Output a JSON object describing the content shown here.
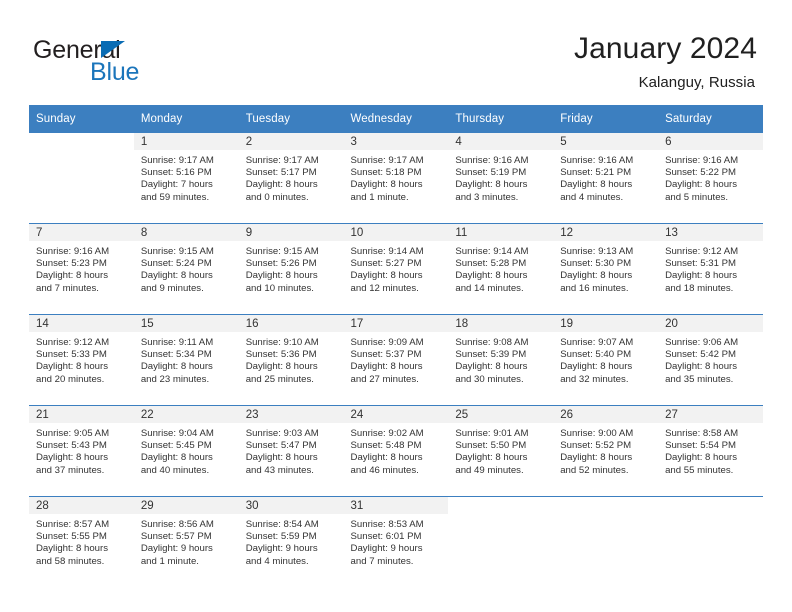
{
  "brand": {
    "name_part1": "General",
    "name_part2": "Blue",
    "triangle_color": "#0a6cb4",
    "blue_text_color": "#1b75bb"
  },
  "header": {
    "title": "January 2024",
    "subtitle": "Kalanguy, Russia"
  },
  "theme": {
    "header_row_bg": "#3c7fc0",
    "header_row_text": "#ffffff",
    "daynum_band_bg": "#f2f2f2",
    "cell_text": "#333333",
    "week_divider": "#3c7fc0"
  },
  "weekdays": [
    "Sunday",
    "Monday",
    "Tuesday",
    "Wednesday",
    "Thursday",
    "Friday",
    "Saturday"
  ],
  "weeks": [
    [
      {
        "day": "",
        "sunrise": "",
        "sunset": "",
        "daylight1": "",
        "daylight2": "",
        "blank": true
      },
      {
        "day": "1",
        "sunrise": "Sunrise: 9:17 AM",
        "sunset": "Sunset: 5:16 PM",
        "daylight1": "Daylight: 7 hours",
        "daylight2": "and 59 minutes."
      },
      {
        "day": "2",
        "sunrise": "Sunrise: 9:17 AM",
        "sunset": "Sunset: 5:17 PM",
        "daylight1": "Daylight: 8 hours",
        "daylight2": "and 0 minutes."
      },
      {
        "day": "3",
        "sunrise": "Sunrise: 9:17 AM",
        "sunset": "Sunset: 5:18 PM",
        "daylight1": "Daylight: 8 hours",
        "daylight2": "and 1 minute."
      },
      {
        "day": "4",
        "sunrise": "Sunrise: 9:16 AM",
        "sunset": "Sunset: 5:19 PM",
        "daylight1": "Daylight: 8 hours",
        "daylight2": "and 3 minutes."
      },
      {
        "day": "5",
        "sunrise": "Sunrise: 9:16 AM",
        "sunset": "Sunset: 5:21 PM",
        "daylight1": "Daylight: 8 hours",
        "daylight2": "and 4 minutes."
      },
      {
        "day": "6",
        "sunrise": "Sunrise: 9:16 AM",
        "sunset": "Sunset: 5:22 PM",
        "daylight1": "Daylight: 8 hours",
        "daylight2": "and 5 minutes."
      }
    ],
    [
      {
        "day": "7",
        "sunrise": "Sunrise: 9:16 AM",
        "sunset": "Sunset: 5:23 PM",
        "daylight1": "Daylight: 8 hours",
        "daylight2": "and 7 minutes."
      },
      {
        "day": "8",
        "sunrise": "Sunrise: 9:15 AM",
        "sunset": "Sunset: 5:24 PM",
        "daylight1": "Daylight: 8 hours",
        "daylight2": "and 9 minutes."
      },
      {
        "day": "9",
        "sunrise": "Sunrise: 9:15 AM",
        "sunset": "Sunset: 5:26 PM",
        "daylight1": "Daylight: 8 hours",
        "daylight2": "and 10 minutes."
      },
      {
        "day": "10",
        "sunrise": "Sunrise: 9:14 AM",
        "sunset": "Sunset: 5:27 PM",
        "daylight1": "Daylight: 8 hours",
        "daylight2": "and 12 minutes."
      },
      {
        "day": "11",
        "sunrise": "Sunrise: 9:14 AM",
        "sunset": "Sunset: 5:28 PM",
        "daylight1": "Daylight: 8 hours",
        "daylight2": "and 14 minutes."
      },
      {
        "day": "12",
        "sunrise": "Sunrise: 9:13 AM",
        "sunset": "Sunset: 5:30 PM",
        "daylight1": "Daylight: 8 hours",
        "daylight2": "and 16 minutes."
      },
      {
        "day": "13",
        "sunrise": "Sunrise: 9:12 AM",
        "sunset": "Sunset: 5:31 PM",
        "daylight1": "Daylight: 8 hours",
        "daylight2": "and 18 minutes."
      }
    ],
    [
      {
        "day": "14",
        "sunrise": "Sunrise: 9:12 AM",
        "sunset": "Sunset: 5:33 PM",
        "daylight1": "Daylight: 8 hours",
        "daylight2": "and 20 minutes."
      },
      {
        "day": "15",
        "sunrise": "Sunrise: 9:11 AM",
        "sunset": "Sunset: 5:34 PM",
        "daylight1": "Daylight: 8 hours",
        "daylight2": "and 23 minutes."
      },
      {
        "day": "16",
        "sunrise": "Sunrise: 9:10 AM",
        "sunset": "Sunset: 5:36 PM",
        "daylight1": "Daylight: 8 hours",
        "daylight2": "and 25 minutes."
      },
      {
        "day": "17",
        "sunrise": "Sunrise: 9:09 AM",
        "sunset": "Sunset: 5:37 PM",
        "daylight1": "Daylight: 8 hours",
        "daylight2": "and 27 minutes."
      },
      {
        "day": "18",
        "sunrise": "Sunrise: 9:08 AM",
        "sunset": "Sunset: 5:39 PM",
        "daylight1": "Daylight: 8 hours",
        "daylight2": "and 30 minutes."
      },
      {
        "day": "19",
        "sunrise": "Sunrise: 9:07 AM",
        "sunset": "Sunset: 5:40 PM",
        "daylight1": "Daylight: 8 hours",
        "daylight2": "and 32 minutes."
      },
      {
        "day": "20",
        "sunrise": "Sunrise: 9:06 AM",
        "sunset": "Sunset: 5:42 PM",
        "daylight1": "Daylight: 8 hours",
        "daylight2": "and 35 minutes."
      }
    ],
    [
      {
        "day": "21",
        "sunrise": "Sunrise: 9:05 AM",
        "sunset": "Sunset: 5:43 PM",
        "daylight1": "Daylight: 8 hours",
        "daylight2": "and 37 minutes."
      },
      {
        "day": "22",
        "sunrise": "Sunrise: 9:04 AM",
        "sunset": "Sunset: 5:45 PM",
        "daylight1": "Daylight: 8 hours",
        "daylight2": "and 40 minutes."
      },
      {
        "day": "23",
        "sunrise": "Sunrise: 9:03 AM",
        "sunset": "Sunset: 5:47 PM",
        "daylight1": "Daylight: 8 hours",
        "daylight2": "and 43 minutes."
      },
      {
        "day": "24",
        "sunrise": "Sunrise: 9:02 AM",
        "sunset": "Sunset: 5:48 PM",
        "daylight1": "Daylight: 8 hours",
        "daylight2": "and 46 minutes."
      },
      {
        "day": "25",
        "sunrise": "Sunrise: 9:01 AM",
        "sunset": "Sunset: 5:50 PM",
        "daylight1": "Daylight: 8 hours",
        "daylight2": "and 49 minutes."
      },
      {
        "day": "26",
        "sunrise": "Sunrise: 9:00 AM",
        "sunset": "Sunset: 5:52 PM",
        "daylight1": "Daylight: 8 hours",
        "daylight2": "and 52 minutes."
      },
      {
        "day": "27",
        "sunrise": "Sunrise: 8:58 AM",
        "sunset": "Sunset: 5:54 PM",
        "daylight1": "Daylight: 8 hours",
        "daylight2": "and 55 minutes."
      }
    ],
    [
      {
        "day": "28",
        "sunrise": "Sunrise: 8:57 AM",
        "sunset": "Sunset: 5:55 PM",
        "daylight1": "Daylight: 8 hours",
        "daylight2": "and 58 minutes."
      },
      {
        "day": "29",
        "sunrise": "Sunrise: 8:56 AM",
        "sunset": "Sunset: 5:57 PM",
        "daylight1": "Daylight: 9 hours",
        "daylight2": "and 1 minute."
      },
      {
        "day": "30",
        "sunrise": "Sunrise: 8:54 AM",
        "sunset": "Sunset: 5:59 PM",
        "daylight1": "Daylight: 9 hours",
        "daylight2": "and 4 minutes."
      },
      {
        "day": "31",
        "sunrise": "Sunrise: 8:53 AM",
        "sunset": "Sunset: 6:01 PM",
        "daylight1": "Daylight: 9 hours",
        "daylight2": "and 7 minutes."
      },
      {
        "day": "",
        "sunrise": "",
        "sunset": "",
        "daylight1": "",
        "daylight2": "",
        "blank": true
      },
      {
        "day": "",
        "sunrise": "",
        "sunset": "",
        "daylight1": "",
        "daylight2": "",
        "blank": true
      },
      {
        "day": "",
        "sunrise": "",
        "sunset": "",
        "daylight1": "",
        "daylight2": "",
        "blank": true
      }
    ]
  ]
}
